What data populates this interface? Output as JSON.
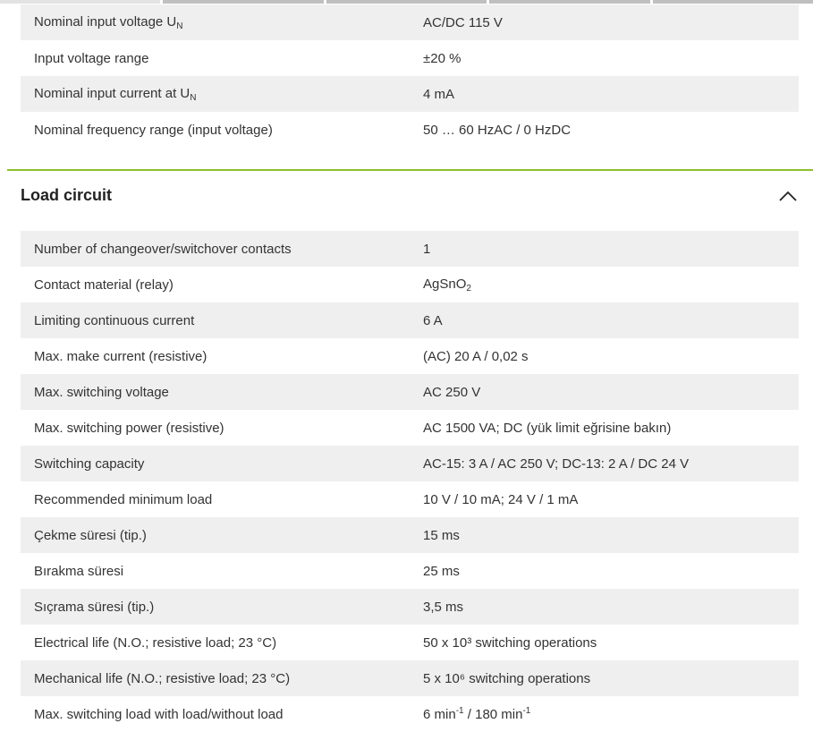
{
  "colors": {
    "row_shade": "#efefef",
    "accent_green": "#8fbf2b",
    "text": "#333333"
  },
  "input_circuit": {
    "rows": [
      {
        "label": "Nominal input voltage U",
        "label_sub": "N",
        "value": "AC/DC 115 V"
      },
      {
        "label": "Input voltage range",
        "value": "±20 %"
      },
      {
        "label": "Nominal input current at U",
        "label_sub": "N",
        "value": "4 mA"
      },
      {
        "label": "Nominal frequency range (input voltage)",
        "value": "50 … 60 HzAC / 0 HzDC"
      }
    ]
  },
  "load_circuit": {
    "title": "Load circuit",
    "toggle_icon": "chevron-up-icon",
    "rows": [
      {
        "label": "Number of changeover/switchover contacts",
        "value": "1"
      },
      {
        "label": "Contact material (relay)",
        "value": "AgSnO",
        "value_sub": "2"
      },
      {
        "label": "Limiting continuous current",
        "value": "6 A"
      },
      {
        "label": "Max. make current (resistive)",
        "value": "(AC) 20 A / 0,02 s"
      },
      {
        "label": "Max. switching voltage",
        "value": "AC 250 V"
      },
      {
        "label": "Max. switching power (resistive)",
        "value": "AC 1500 VA; DC (yük limit eğrisine bakın)"
      },
      {
        "label": "Switching capacity",
        "value": "AC-15: 3 A / AC 250 V; DC-13: 2 A / DC 24 V"
      },
      {
        "label": "Recommended minimum load",
        "value": "10 V / 10 mA; 24 V / 1 mA"
      },
      {
        "label": "Çekme süresi (tip.)",
        "value": "15 ms"
      },
      {
        "label": "Bırakma süresi",
        "value": "25 ms"
      },
      {
        "label": "Sıçrama süresi (tip.)",
        "value": "3,5 ms"
      },
      {
        "label": "Electrical life (N.O.; resistive load; 23 °C)",
        "value": "50 x 10³ switching operations"
      },
      {
        "label": "Mechanical life (N.O.; resistive load; 23 °C)",
        "value": "5 x 10⁶ switching operations"
      },
      {
        "label": "Max. switching load with load/without load",
        "value_parts": [
          "6 min",
          "-1",
          " / 180 min",
          "-1"
        ]
      }
    ]
  }
}
